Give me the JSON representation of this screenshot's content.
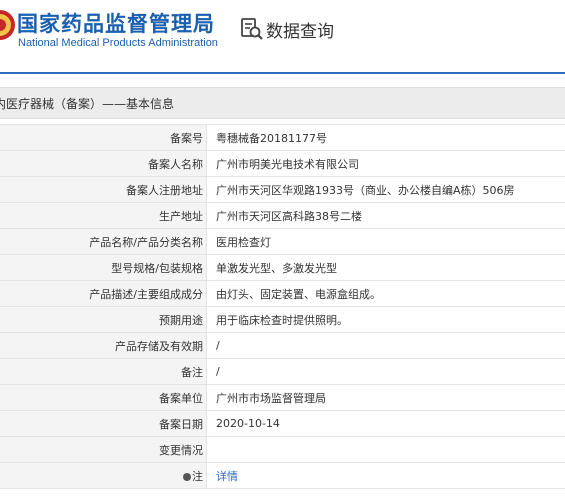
{
  "header": {
    "site_name_cn": "国家药品监督管理局",
    "site_name_en": "National Medical Products Administration",
    "query_title": "数据查询"
  },
  "section": {
    "title": "内医疗器械（备案）——基本信息"
  },
  "rows": [
    {
      "label": "备案号",
      "value": "粤穗械备20181177号"
    },
    {
      "label": "备案人名称",
      "value": "广州市明美光电技术有限公司"
    },
    {
      "label": "备案人注册地址",
      "value": "广州市天河区华观路1933号（商业、办公楼自编A栋）506房"
    },
    {
      "label": "生产地址",
      "value": "广州市天河区高科路38号二楼"
    },
    {
      "label": "产品名称/产品分类名称",
      "value": "医用检查灯"
    },
    {
      "label": "型号规格/包装规格",
      "value": "单激发光型、多激发光型"
    },
    {
      "label": "产品描述/主要组成成分",
      "value": "由灯头、固定装置、电源盒组成。"
    },
    {
      "label": "预期用途",
      "value": "用于临床检查时提供照明。"
    },
    {
      "label": "产品存储及有效期",
      "value": "/"
    },
    {
      "label": "备注",
      "value": "/"
    },
    {
      "label": "备案单位",
      "value": "广州市市场监督管理局"
    },
    {
      "label": "备案日期",
      "value": "2020-10-14"
    },
    {
      "label": "变更情况",
      "value": ""
    },
    {
      "label": "注",
      "value": "详情"
    }
  ],
  "colors": {
    "brand_blue": "#1a5fb0",
    "link_blue": "#2a6bc4",
    "label_bg": "#f4f4f4",
    "section_bg": "#ececec"
  }
}
